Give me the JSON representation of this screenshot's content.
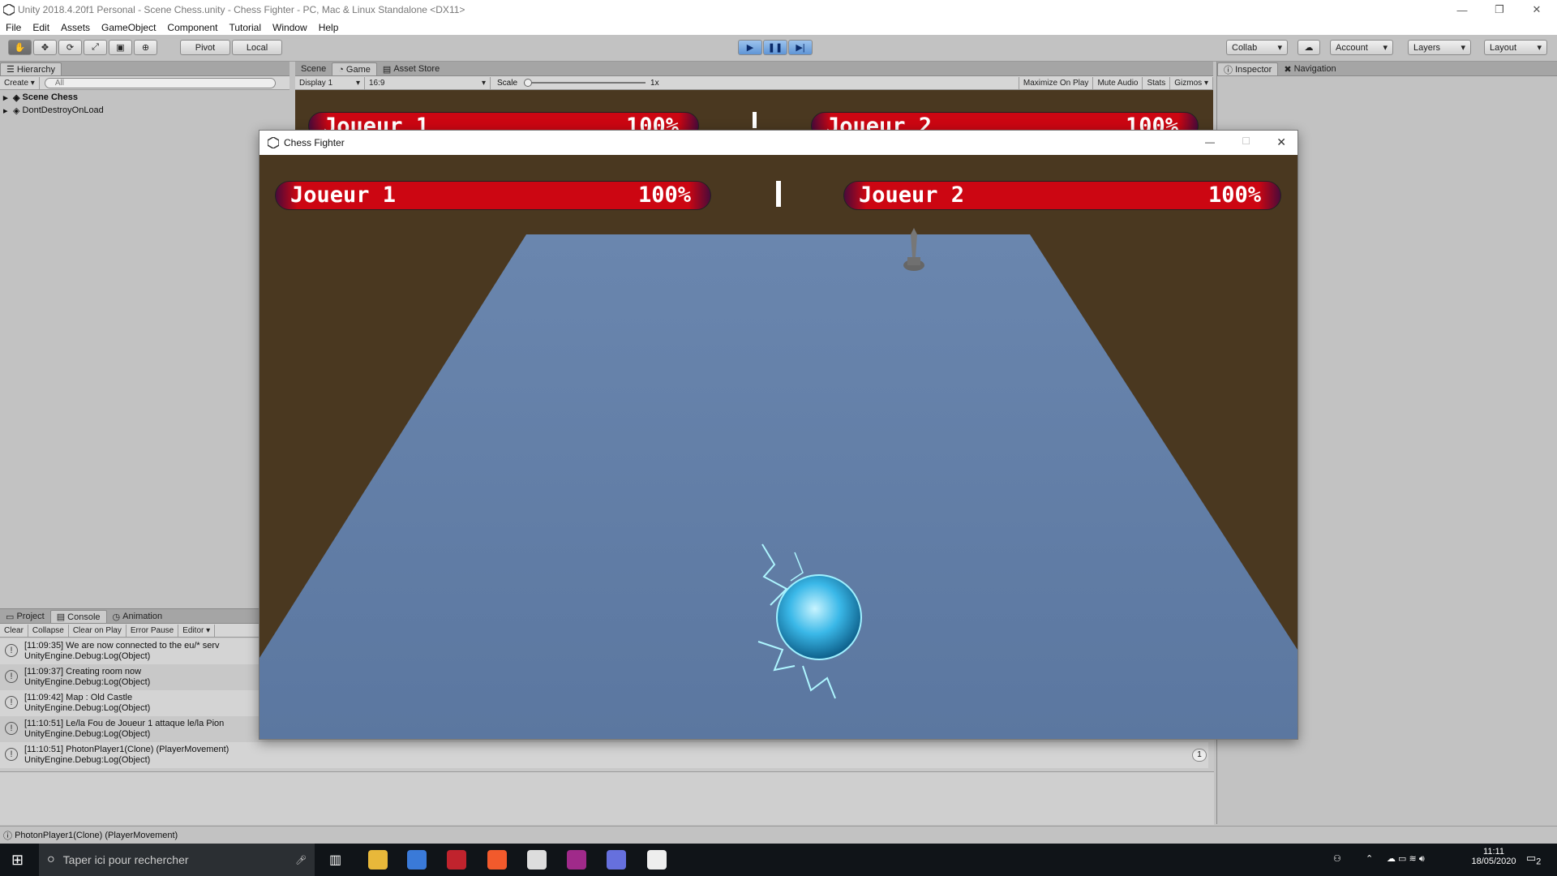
{
  "window": {
    "title": "Unity 2018.4.20f1 Personal - Scene Chess.unity - Chess Fighter - PC, Mac & Linux Standalone <DX11>",
    "min_icon": "minimize-icon",
    "max_icon": "restore-icon",
    "close_icon": "close-icon"
  },
  "menu": [
    "File",
    "Edit",
    "Assets",
    "GameObject",
    "Component",
    "Tutorial",
    "Window",
    "Help"
  ],
  "toolbar": {
    "pivot": "Pivot",
    "local": "Local",
    "collab": "Collab",
    "account": "Account",
    "layers": "Layers",
    "layout": "Layout"
  },
  "hierarchy": {
    "tab": "Hierarchy",
    "create": "Create",
    "search_placeholder": "All",
    "items": [
      "Scene Chess",
      "DontDestroyOnLoad"
    ]
  },
  "scene_tabs": {
    "scene": "Scene",
    "game": "Game",
    "asset_store": "Asset Store"
  },
  "game_bar": {
    "display": "Display 1",
    "aspect": "16:9",
    "scale_label": "Scale",
    "scale_value": "1x",
    "maximize": "Maximize On Play",
    "mute": "Mute Audio",
    "stats": "Stats",
    "gizmos": "Gizmos"
  },
  "inspector_tabs": {
    "inspector": "Inspector",
    "navigation": "Navigation"
  },
  "bottom_tabs": {
    "project": "Project",
    "console": "Console",
    "animation": "Animation"
  },
  "console_bar": {
    "clear": "Clear",
    "collapse": "Collapse",
    "clear_on_play": "Clear on Play",
    "error_pause": "Error Pause",
    "editor": "Editor"
  },
  "console_logs": [
    {
      "line1": "[11:09:35] We are now connected to the eu/* serv",
      "line2": "UnityEngine.Debug:Log(Object)"
    },
    {
      "line1": "[11:09:37] Creating room now",
      "line2": "UnityEngine.Debug:Log(Object)"
    },
    {
      "line1": "[11:09:42] Map : Old Castle",
      "line2": "UnityEngine.Debug:Log(Object)"
    },
    {
      "line1": "[11:10:51] Le/la Fou de Joueur 1 attaque le/la Pion",
      "line2": "UnityEngine.Debug:Log(Object)"
    },
    {
      "line1": "[11:10:51] PhotonPlayer1(Clone) (PlayerMovement)",
      "line2": "UnityEngine.Debug:Log(Object)"
    }
  ],
  "console_count": "1",
  "status_text": "PhotonPlayer1(Clone) (PlayerMovement)",
  "game_window": {
    "title": "Chess Fighter",
    "player1": {
      "name": "Joueur 1",
      "health": "100%"
    },
    "player2": {
      "name": "Joueur 2",
      "health": "100%"
    }
  },
  "taskbar": {
    "search_placeholder": "Taper ici pour rechercher",
    "time": "11:11",
    "date": "18/05/2020",
    "notif": "2"
  },
  "colors": {
    "game_bg": "#4a3820",
    "board": "#6680a8",
    "health_red": "#cc0612",
    "orb": "#3ab8e8"
  }
}
